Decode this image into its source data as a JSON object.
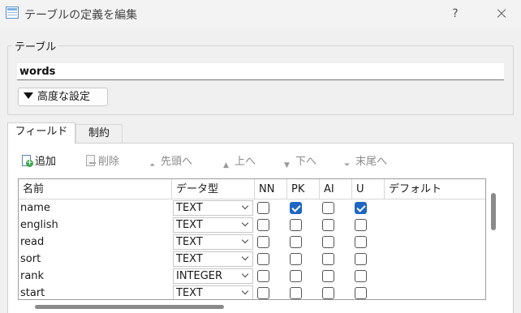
{
  "window": {
    "title": "テーブルの定義を編集",
    "help_label": "?"
  },
  "table_group": {
    "label": "テーブル",
    "name_value": "words",
    "advanced_label": "高度な設定"
  },
  "tabs": [
    {
      "label": "フィールド",
      "selected": true
    },
    {
      "label": "制約",
      "selected": false
    }
  ],
  "toolbar": {
    "add": {
      "label": "追加",
      "icon": "add-field-icon",
      "enabled": true
    },
    "delete": {
      "label": "削除",
      "icon": "delete-field-icon",
      "enabled": false
    },
    "move_top": {
      "label": "先頭へ",
      "icon": "move-top-icon",
      "enabled": false
    },
    "move_up": {
      "label": "上へ",
      "icon": "move-up-icon",
      "enabled": false
    },
    "move_down": {
      "label": "下へ",
      "icon": "move-down-icon",
      "enabled": false
    },
    "move_bottom": {
      "label": "末尾へ",
      "icon": "move-bottom-icon",
      "enabled": false
    }
  },
  "grid": {
    "headers": [
      "名前",
      "データ型",
      "NN",
      "PK",
      "AI",
      "U",
      "デフォルト"
    ],
    "rows": [
      {
        "name": "name",
        "type": "TEXT",
        "nn": false,
        "pk": true,
        "ai": false,
        "u": true
      },
      {
        "name": "english",
        "type": "TEXT",
        "nn": false,
        "pk": false,
        "ai": false,
        "u": false
      },
      {
        "name": "read",
        "type": "TEXT",
        "nn": false,
        "pk": false,
        "ai": false,
        "u": false
      },
      {
        "name": "sort",
        "type": "TEXT",
        "nn": false,
        "pk": false,
        "ai": false,
        "u": false
      },
      {
        "name": "rank",
        "type": "INTEGER",
        "nn": false,
        "pk": false,
        "ai": false,
        "u": false
      },
      {
        "name": "start",
        "type": "TEXT",
        "nn": false,
        "pk": false,
        "ai": false,
        "u": false
      }
    ]
  },
  "colors": {
    "checkbox_checked": "#1e66c4",
    "add_icon_green": "#3aa64b"
  }
}
